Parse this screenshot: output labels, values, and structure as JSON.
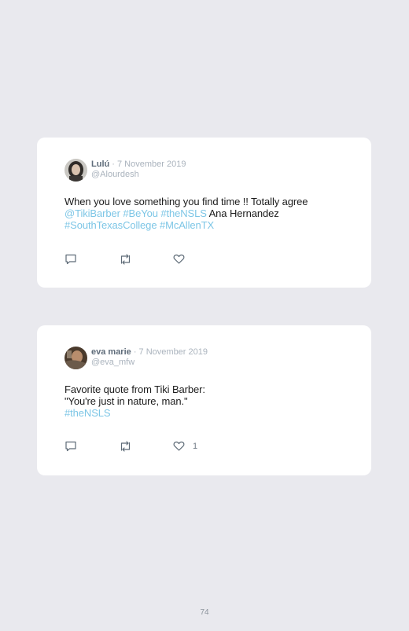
{
  "tweets": [
    {
      "name": "Lulú",
      "date": "· 7 November 2019",
      "handle": "@Alourdesh",
      "text_lines": [
        [
          {
            "t": "When you love something you find time !! Totally agree",
            "link": false
          }
        ],
        [
          {
            "t": "@TikiBarber #BeYou #theNSLS",
            "link": true
          },
          {
            "t": " Ana Hernandez",
            "link": false
          }
        ],
        [
          {
            "t": "#SouthTexasCollege #McAllenTX",
            "link": true
          }
        ]
      ],
      "like_count": ""
    },
    {
      "name": "eva marie",
      "date": "· 7 November 2019",
      "handle": "@eva_mfw",
      "text_lines": [
        [
          {
            "t": "Favorite quote from Tiki Barber:",
            "link": false
          }
        ],
        [
          {
            "t": "\"You're just in nature, man.\"",
            "link": false
          }
        ],
        [
          {
            "t": "#theNSLS",
            "link": true
          }
        ]
      ],
      "like_count": "1"
    }
  ],
  "icons": {
    "reply": "reply-icon",
    "retweet": "retweet-icon",
    "like": "heart-icon"
  },
  "page_number": "74"
}
